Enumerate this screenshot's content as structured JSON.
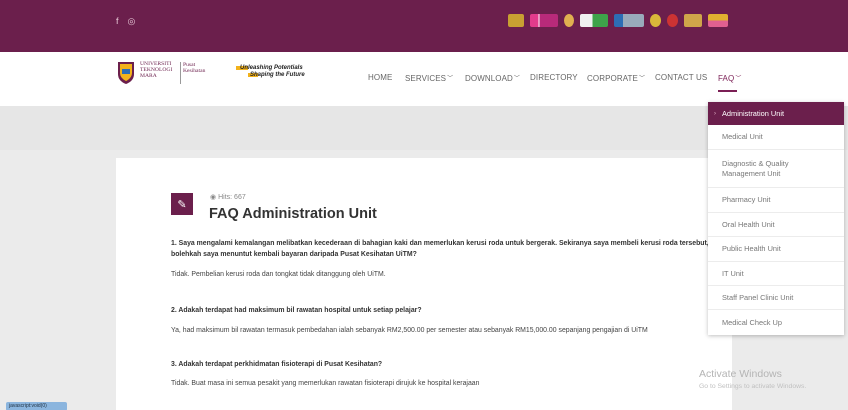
{
  "topbar": {
    "social_icons": [
      {
        "name": "facebook-icon",
        "glyph": "f"
      },
      {
        "name": "instagram-icon",
        "glyph": "◎"
      }
    ],
    "ranking_logos": [
      {
        "name": "qs-stars-logo",
        "color": "#c8a032"
      },
      {
        "name": "the-ranking-logo",
        "color": "#d23c8a"
      },
      {
        "name": "ranking-badge-logo",
        "color": "#e0b050"
      },
      {
        "name": "green-metric-logo",
        "color": "#3ea34a"
      },
      {
        "name": "sirim-logo",
        "color": "#2d6db5"
      },
      {
        "name": "gold-seal-logo",
        "color": "#d9b83a"
      },
      {
        "name": "qs-logo",
        "color": "#d44"
      },
      {
        "name": "mqa-logo",
        "color": "#cfa64a"
      },
      {
        "name": "five-star-logo",
        "color": "#e0b030"
      }
    ]
  },
  "header": {
    "university": [
      "UNIVERSITI",
      "TEKNOLOGI",
      "MARA"
    ],
    "unit": [
      "Pusat",
      "Kesihatan"
    ],
    "tagline": [
      "Unleashing Potentials",
      "Shaping the Future"
    ],
    "nav": [
      {
        "label": "HOME",
        "has_caret": false
      },
      {
        "label": "SERVICES",
        "has_caret": true
      },
      {
        "label": "DOWNLOAD",
        "has_caret": true
      },
      {
        "label": "DIRECTORY",
        "has_caret": false
      },
      {
        "label": "CORPORATE",
        "has_caret": true
      },
      {
        "label": "CONTACT US",
        "has_caret": false
      },
      {
        "label": "FAQ",
        "has_caret": true,
        "active": true
      }
    ]
  },
  "faq_menu": {
    "items": [
      "Administration Unit",
      "Medical Unit",
      "Diagnostic & Quality Management Unit",
      "Pharmacy Unit",
      "Oral Health Unit",
      "Public Health Unit",
      "IT Unit",
      "Staff Panel Clinic Unit",
      "Medical Check Up"
    ],
    "active_index": 0
  },
  "article": {
    "hits": "Hits: 667",
    "title": "FAQ Administration Unit",
    "qa": [
      {
        "q": "1. Saya mengalami kemalangan melibatkan kecederaan di bahagian kaki dan memerlukan kerusi roda untuk bergerak. Sekiranya saya membeli kerusi roda tersebut, bolehkah saya menuntut kembali bayaran daripada Pusat Kesihatan UiTM?",
        "a": "Tidak. Pembelian kerusi roda dan tongkat tidak ditanggung oleh UiTM."
      },
      {
        "q": "2. Adakah terdapat had maksimum bil rawatan hospital untuk setiap pelajar?",
        "a": "Ya, had maksimum bil rawatan termasuk pembedahan ialah sebanyak RM2,500.00 per semester atau sebanyak RM15,000.00 sepanjang pengajian di UiTM"
      },
      {
        "q": "3. Adakah terdapat perkhidmatan fisioterapi di Pusat Kesihatan?",
        "a": "Tidak. Buat masa ini semua pesakit yang memerlukan rawatan fisioterapi dirujuk ke hospital kerajaan"
      }
    ]
  },
  "watermark": {
    "line1": "Activate Windows",
    "line2": "Go to Settings to activate Windows."
  },
  "status_chip": "javascript:void(0)"
}
